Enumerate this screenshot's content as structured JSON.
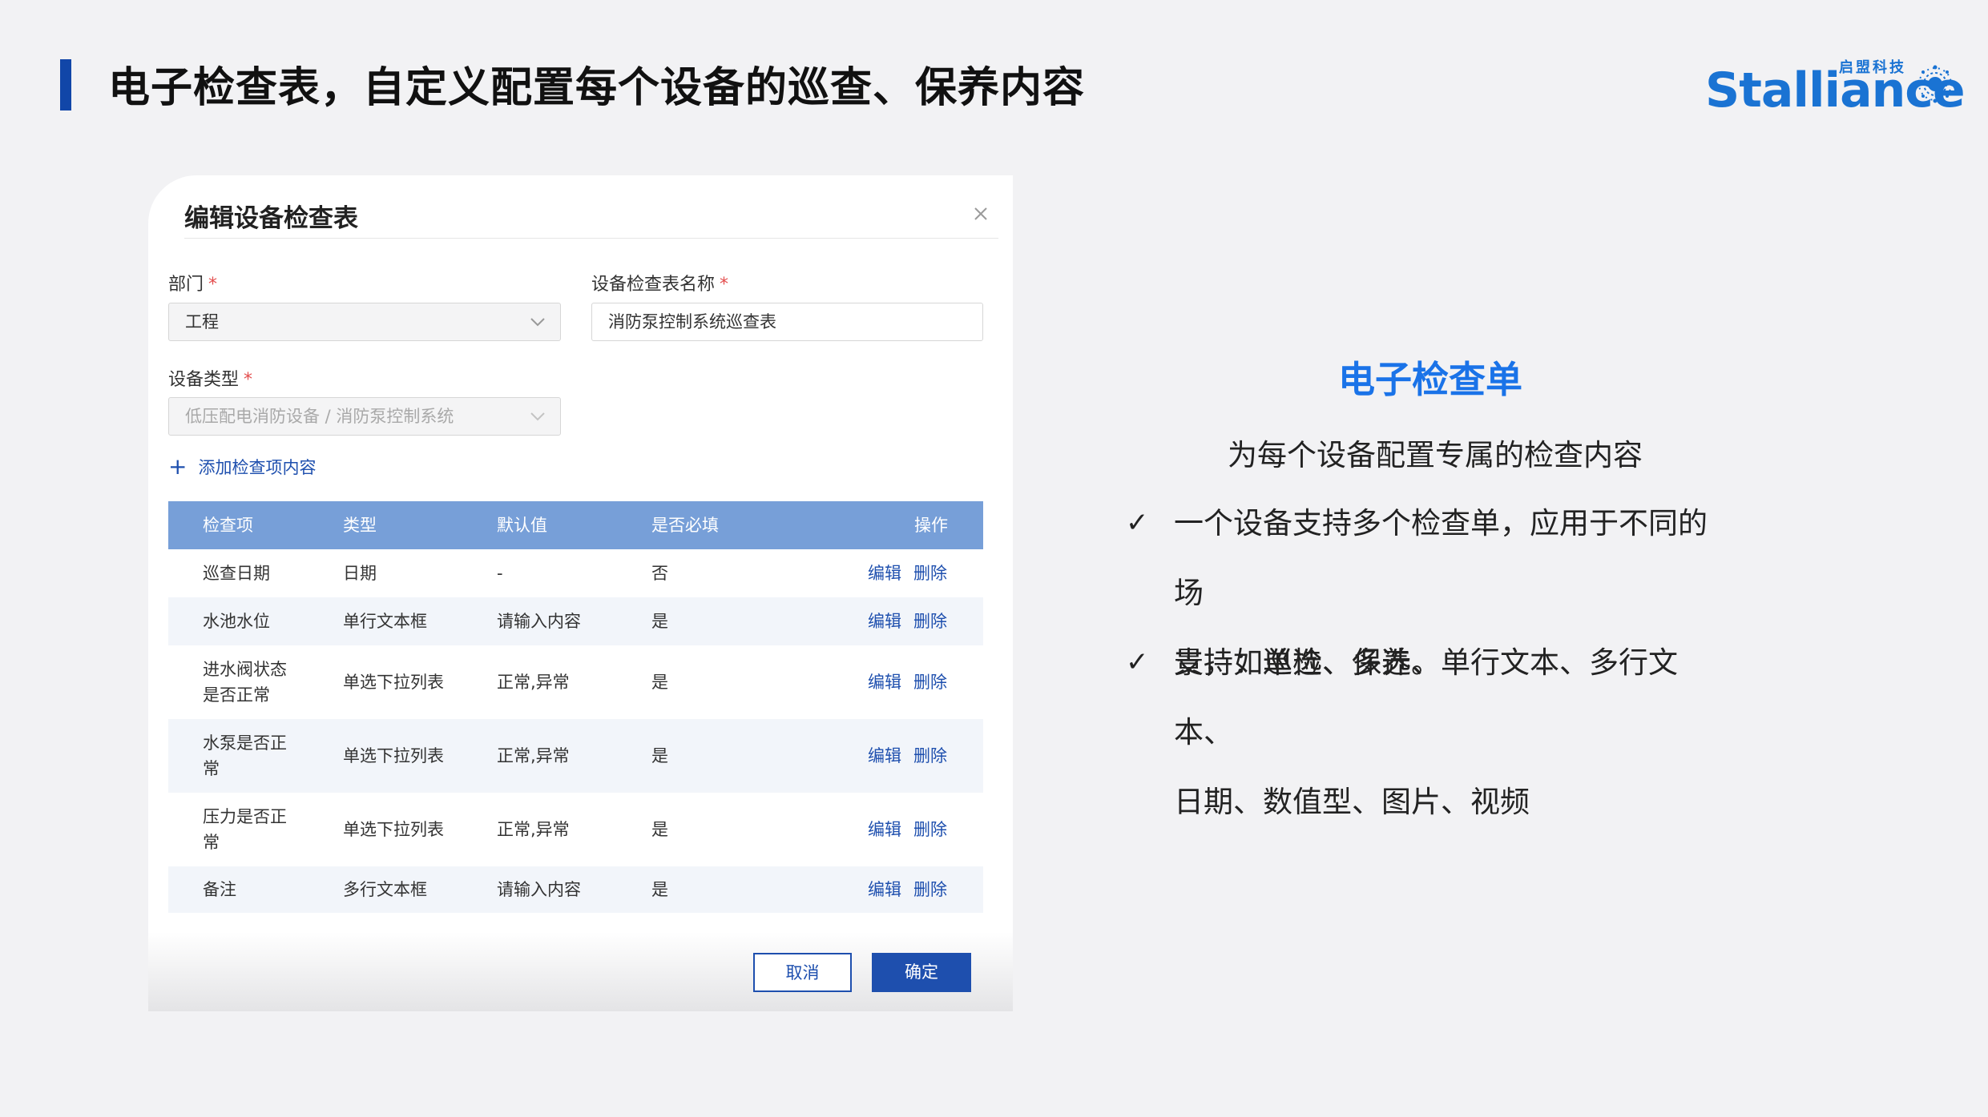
{
  "slide": {
    "title": "电子检查表，自定义配置每个设备的巡查、保养内容"
  },
  "logo": {
    "word": "Stalliance",
    "chinese": "启盟科技",
    "brand_color": "#1a73d3"
  },
  "dialog": {
    "title": "编辑设备检查表",
    "dept_label": "部门",
    "dept_value": "工程",
    "name_label": "设备检查表名称",
    "name_value": "消防泵控制系统巡查表",
    "type_label": "设备类型",
    "type_value": "低压配电消防设备 / 消防泵控制系统",
    "required_mark": "*",
    "add_item": "添加检查项内容",
    "table": {
      "headers": [
        "检查项",
        "类型",
        "默认值",
        "是否必填",
        "操作"
      ],
      "rows": [
        {
          "item_lines": [
            "巡查日期"
          ],
          "type": "日期",
          "default": "-",
          "required": "否"
        },
        {
          "item_lines": [
            "水池水位"
          ],
          "type": "单行文本框",
          "default": "请输入内容",
          "required": "是"
        },
        {
          "item_lines": [
            "进水阀状态",
            "是否正常"
          ],
          "type": "单选下拉列表",
          "default": "正常,异常",
          "required": "是"
        },
        {
          "item_lines": [
            "水泵是否正",
            "常"
          ],
          "type": "单选下拉列表",
          "default": "正常,异常",
          "required": "是"
        },
        {
          "item_lines": [
            "压力是否正",
            "常"
          ],
          "type": "单选下拉列表",
          "default": "正常,异常",
          "required": "是"
        },
        {
          "item_lines": [
            "备注"
          ],
          "type": "多行文本框",
          "default": "请输入内容",
          "required": "是"
        }
      ],
      "edit_label": "编辑",
      "delete_label": "删除"
    },
    "cancel_label": "取消",
    "ok_label": "确定",
    "accent_color": "#1e4fae",
    "header_color": "#779fd8"
  },
  "side": {
    "title": "电子检查单",
    "subtitle": "为每个设备配置专属的检查内容",
    "check_symbol": "✓",
    "bullets": [
      {
        "lines": [
          "一个设备支持多个检查单，应用于不同的场",
          "景，如巡检、保养。"
        ]
      },
      {
        "lines": [
          "支持：单选、多选、单行文本、多行文本、",
          "日期、数值型、图片、视频"
        ]
      }
    ],
    "title_color": "#1a73e8"
  }
}
